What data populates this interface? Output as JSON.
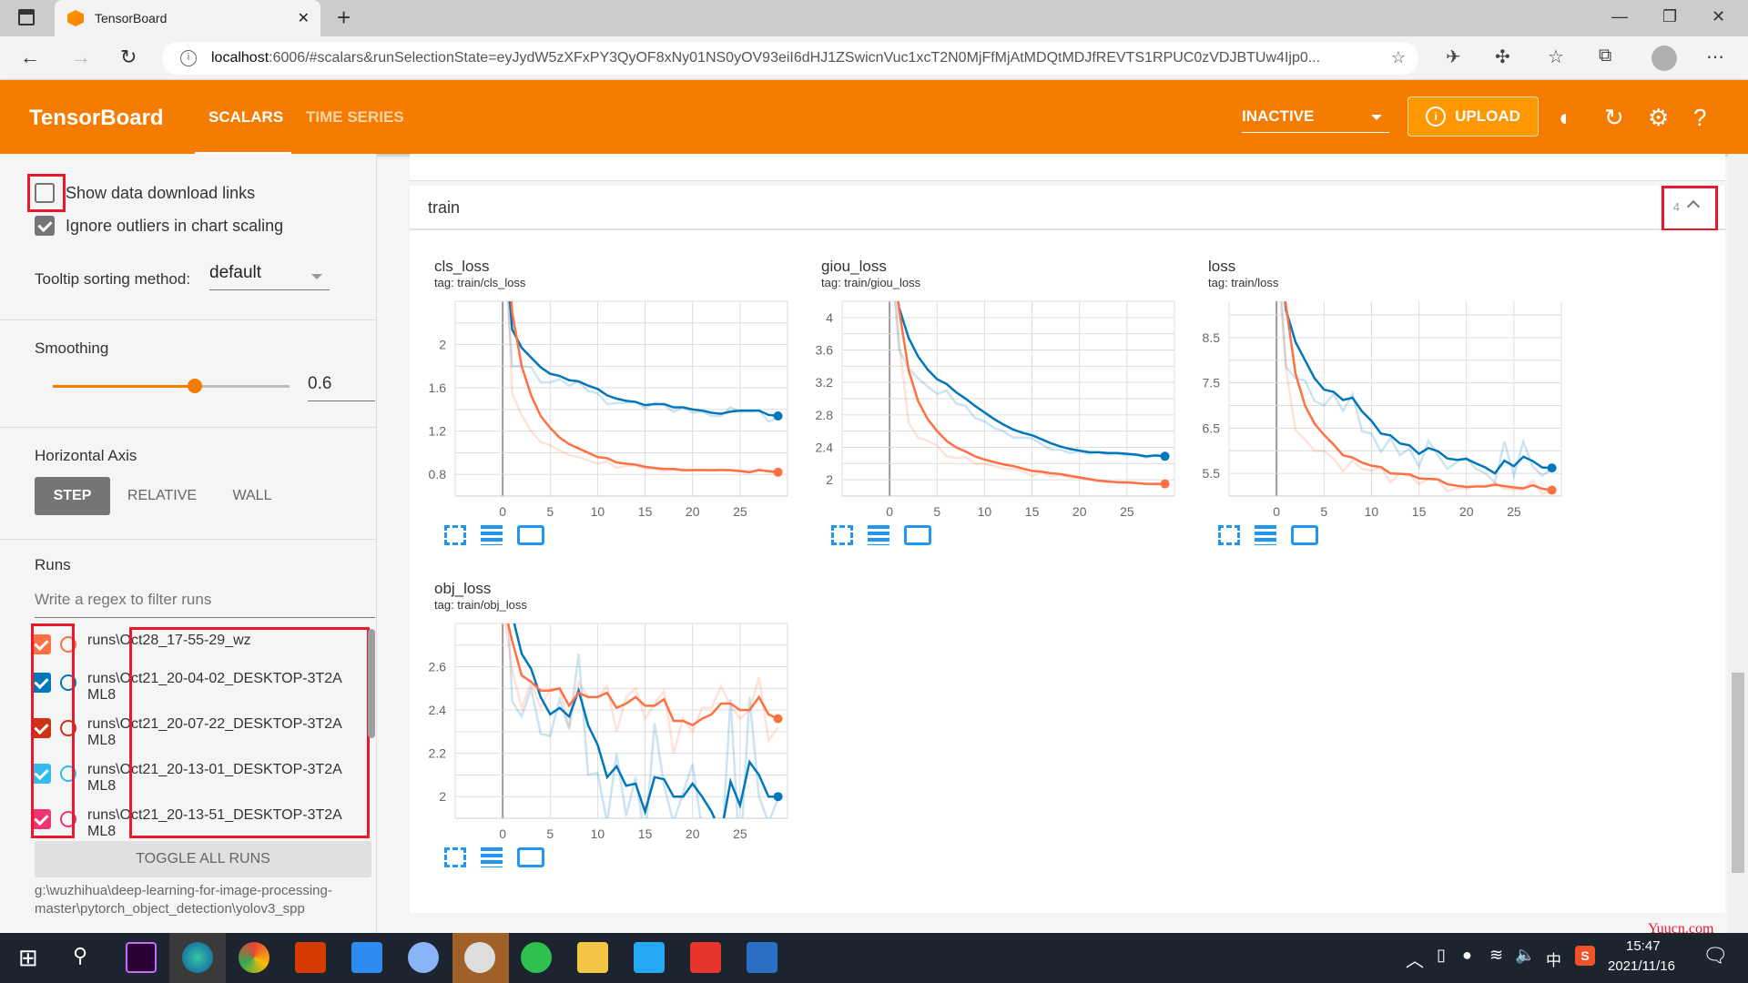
{
  "browser": {
    "tab_title": "TensorBoard",
    "url_host": "localhost",
    "url_rest": ":6006/#scalars&runSelectionState=eyJydW5zXFxPY3QyOF8xNy01NS0yOV93eiI6dHJ1ZSwicnVuc1xcT2N0MjFfMjAtMDQtMDJfREVTS1RPUC0zVDJBTUw4Ijp0..."
  },
  "toolbar": {
    "brand": "TensorBoard",
    "tabs": [
      {
        "label": "SCALARS",
        "active": true
      },
      {
        "label": "TIME SERIES",
        "active": false
      }
    ],
    "run_selector": "INACTIVE",
    "upload_label": "UPLOAD"
  },
  "sidebar": {
    "show_download_links": {
      "label": "Show data download links",
      "checked": false
    },
    "ignore_outliers": {
      "label": "Ignore outliers in chart scaling",
      "checked": true
    },
    "tooltip_label": "Tooltip sorting method:",
    "tooltip_value": "default",
    "smoothing_label": "Smoothing",
    "smoothing_value": "0.6",
    "smoothing_fraction": 0.6,
    "horizontal_axis_label": "Horizontal Axis",
    "axis_options": [
      "STEP",
      "RELATIVE",
      "WALL"
    ],
    "axis_selected": "STEP",
    "runs_label": "Runs",
    "filter_placeholder": "Write a regex to filter runs",
    "runs": [
      {
        "name": "runs\\Oct28_17-55-29_wz",
        "color": "#ff7043",
        "checked": true
      },
      {
        "name": "runs\\Oct21_20-04-02_DESKTOP-3T2AML8",
        "color": "#0077bb",
        "checked": true
      },
      {
        "name": "runs\\Oct21_20-07-22_DESKTOP-3T2AML8",
        "color": "#cc3311",
        "checked": true
      },
      {
        "name": "runs\\Oct21_20-13-01_DESKTOP-3T2AML8",
        "color": "#33bbee",
        "checked": true
      },
      {
        "name": "runs\\Oct21_20-13-51_DESKTOP-3T2AML8",
        "color": "#ee3377",
        "checked": true
      }
    ],
    "toggle_all": "TOGGLE ALL RUNS",
    "logdir": "g:\\wuzhihua\\deep-learning-for-image-processing-master\\pytorch_object_detection\\yolov3_spp"
  },
  "category": {
    "name": "train",
    "count": "4"
  },
  "chart_data": [
    {
      "type": "line",
      "title": "cls_loss",
      "tag": "tag: train/cls_loss",
      "xlim": [
        -5,
        30
      ],
      "ylim": [
        0.6,
        2.4
      ],
      "xticks": [
        0,
        5,
        10,
        15,
        20,
        25
      ],
      "yticks": [
        0.8,
        1.2,
        1.6,
        2
      ],
      "series": [
        {
          "name": "runs\\Oct21_20-04-02_DESKTOP-3T2AML8",
          "color": "#0077bb",
          "raw": [
            3.2,
            1.8,
            1.8,
            1.79,
            1.65,
            1.65,
            1.68,
            1.62,
            1.66,
            1.57,
            1.55,
            1.45,
            1.46,
            1.46,
            1.47,
            1.41,
            1.46,
            1.44,
            1.38,
            1.42,
            1.37,
            1.38,
            1.34,
            1.34,
            1.42,
            1.38,
            1.38,
            1.39,
            1.29,
            1.32
          ],
          "smoothed": [
            3.2,
            2.14,
            1.97,
            1.88,
            1.79,
            1.73,
            1.71,
            1.67,
            1.66,
            1.62,
            1.59,
            1.53,
            1.5,
            1.48,
            1.47,
            1.44,
            1.45,
            1.45,
            1.42,
            1.42,
            1.4,
            1.39,
            1.37,
            1.36,
            1.38,
            1.39,
            1.39,
            1.39,
            1.35,
            1.34
          ]
        },
        {
          "name": "runs\\Oct28_17-55-29_wz",
          "color": "#ff7043",
          "raw": [
            3.5,
            1.55,
            1.35,
            1.2,
            1.1,
            1.07,
            1.02,
            0.98,
            0.96,
            0.93,
            0.9,
            0.92,
            0.86,
            0.88,
            0.88,
            0.86,
            0.85,
            0.83,
            0.85,
            0.83,
            0.84,
            0.84,
            0.83,
            0.85,
            0.83,
            0.84,
            0.82,
            0.85,
            0.82,
            0.82
          ],
          "smoothed": [
            3.5,
            2.3,
            1.8,
            1.53,
            1.34,
            1.23,
            1.14,
            1.08,
            1.04,
            1.0,
            0.96,
            0.95,
            0.91,
            0.9,
            0.89,
            0.87,
            0.86,
            0.85,
            0.85,
            0.84,
            0.84,
            0.84,
            0.84,
            0.84,
            0.84,
            0.83,
            0.82,
            0.84,
            0.83,
            0.82
          ]
        }
      ]
    },
    {
      "type": "line",
      "title": "giou_loss",
      "tag": "tag: train/giou_loss",
      "xlim": [
        -5,
        30
      ],
      "ylim": [
        1.8,
        4.2
      ],
      "xticks": [
        0,
        5,
        10,
        15,
        20,
        25
      ],
      "yticks": [
        2,
        2.4,
        2.8,
        3.2,
        3.6,
        4
      ],
      "series": [
        {
          "name": "runs\\Oct21_20-04-02_DESKTOP-3T2AML8",
          "color": "#0077bb",
          "raw": [
            5.0,
            3.6,
            3.38,
            3.25,
            3.15,
            3.06,
            3.1,
            2.94,
            2.91,
            2.76,
            2.72,
            2.64,
            2.6,
            2.52,
            2.52,
            2.51,
            2.44,
            2.37,
            2.37,
            2.33,
            2.35,
            2.32,
            2.34,
            2.31,
            2.32,
            2.3,
            2.31,
            2.27,
            2.31,
            2.29
          ],
          "smoothed": [
            5.0,
            4.12,
            3.75,
            3.52,
            3.36,
            3.24,
            3.18,
            3.08,
            3.0,
            2.91,
            2.83,
            2.75,
            2.68,
            2.62,
            2.58,
            2.55,
            2.5,
            2.45,
            2.41,
            2.38,
            2.36,
            2.34,
            2.34,
            2.33,
            2.33,
            2.32,
            2.31,
            2.29,
            2.3,
            2.29
          ]
        },
        {
          "name": "runs\\Oct28_17-55-29_wz",
          "color": "#ff7043",
          "raw": [
            5.2,
            3.7,
            2.7,
            2.52,
            2.48,
            2.42,
            2.29,
            2.27,
            2.28,
            2.2,
            2.2,
            2.17,
            2.14,
            2.13,
            2.11,
            2.05,
            2.09,
            2.04,
            2.06,
            2.03,
            2.02,
            2.0,
            1.98,
            1.98,
            1.97,
            1.96,
            1.96,
            1.95,
            1.94,
            1.95
          ],
          "smoothed": [
            5.2,
            4.1,
            3.35,
            2.97,
            2.75,
            2.6,
            2.48,
            2.4,
            2.35,
            2.29,
            2.25,
            2.22,
            2.19,
            2.17,
            2.14,
            2.11,
            2.1,
            2.08,
            2.07,
            2.05,
            2.03,
            2.01,
            1.99,
            1.98,
            1.97,
            1.97,
            1.96,
            1.95,
            1.95,
            1.95
          ]
        }
      ]
    },
    {
      "type": "line",
      "title": "loss",
      "tag": "tag: train/loss",
      "xlim": [
        -5,
        30
      ],
      "ylim": [
        5.0,
        9.3
      ],
      "xticks": [
        0,
        5,
        10,
        15,
        20,
        25
      ],
      "yticks": [
        5.5,
        6.5,
        7.5,
        8.5
      ],
      "series": [
        {
          "name": "runs\\Oct21_20-04-02_DESKTOP-3T2AML8",
          "color": "#0077bb",
          "raw": [
            11.0,
            7.85,
            7.6,
            7.55,
            7.1,
            7.0,
            7.25,
            6.88,
            7.25,
            6.43,
            6.38,
            5.97,
            6.28,
            5.9,
            6.05,
            5.65,
            6.22,
            5.9,
            5.6,
            5.75,
            5.85,
            5.6,
            5.5,
            5.3,
            6.2,
            5.45,
            6.2,
            5.65,
            5.45,
            5.6
          ],
          "smoothed": [
            11.0,
            9.1,
            8.4,
            8.0,
            7.6,
            7.35,
            7.3,
            7.12,
            7.17,
            6.87,
            6.66,
            6.38,
            6.34,
            6.16,
            6.12,
            5.93,
            6.06,
            5.99,
            5.83,
            5.8,
            5.82,
            5.72,
            5.63,
            5.5,
            5.78,
            5.66,
            5.87,
            5.77,
            5.63,
            5.62
          ]
        },
        {
          "name": "runs\\Oct28_17-55-29_wz",
          "color": "#ff7043",
          "raw": [
            10.5,
            7.8,
            6.45,
            6.25,
            6.0,
            6.0,
            5.83,
            5.55,
            5.78,
            5.6,
            5.56,
            5.64,
            5.3,
            5.5,
            5.45,
            5.26,
            5.38,
            5.36,
            5.1,
            5.18,
            5.16,
            5.22,
            5.22,
            5.3,
            5.16,
            5.15,
            5.14,
            5.34,
            5.05,
            5.12
          ],
          "smoothed": [
            10.5,
            9.2,
            7.7,
            7.0,
            6.6,
            6.35,
            6.14,
            5.9,
            5.85,
            5.74,
            5.67,
            5.64,
            5.5,
            5.49,
            5.48,
            5.39,
            5.38,
            5.37,
            5.26,
            5.23,
            5.2,
            5.21,
            5.21,
            5.25,
            5.22,
            5.19,
            5.17,
            5.24,
            5.16,
            5.13
          ]
        }
      ]
    },
    {
      "type": "line",
      "title": "obj_loss",
      "tag": "tag: train/obj_loss",
      "xlim": [
        -5,
        30
      ],
      "ylim": [
        1.9,
        2.8
      ],
      "xticks": [
        0,
        5,
        10,
        15,
        20,
        25
      ],
      "yticks": [
        2,
        2.2,
        2.4,
        2.6
      ],
      "series": [
        {
          "name": "runs\\Oct21_20-04-02_DESKTOP-3T2AML8",
          "color": "#0077bb",
          "raw": [
            3.4,
            2.44,
            2.37,
            2.5,
            2.29,
            2.28,
            2.45,
            2.31,
            2.66,
            2.1,
            2.11,
            1.88,
            2.2,
            1.91,
            2.09,
            1.8,
            2.34,
            2.05,
            1.88,
            2.02,
            2.15,
            1.85,
            1.7,
            1.7,
            2.45,
            1.7,
            2.46,
            2.0,
            1.88,
            1.99
          ],
          "smoothed": [
            3.4,
            2.84,
            2.66,
            2.59,
            2.46,
            2.38,
            2.41,
            2.37,
            2.49,
            2.33,
            2.24,
            2.09,
            2.14,
            2.05,
            2.06,
            1.93,
            2.09,
            2.08,
            2.0,
            2.0,
            2.06,
            2.0,
            1.93,
            1.83,
            2.07,
            1.96,
            2.16,
            2.1,
            2.0,
            2.0
          ]
        },
        {
          "name": "runs\\Oct28_17-55-29_wz",
          "color": "#ff7043",
          "raw": [
            2.9,
            2.58,
            2.41,
            2.53,
            2.41,
            2.5,
            2.5,
            2.32,
            2.53,
            2.46,
            2.46,
            2.51,
            2.3,
            2.46,
            2.5,
            2.36,
            2.43,
            2.49,
            2.2,
            2.36,
            2.3,
            2.41,
            2.41,
            2.51,
            2.42,
            2.36,
            2.4,
            2.55,
            2.26,
            2.32
          ],
          "smoothed": [
            2.9,
            2.72,
            2.56,
            2.53,
            2.49,
            2.49,
            2.5,
            2.42,
            2.48,
            2.46,
            2.46,
            2.48,
            2.41,
            2.43,
            2.46,
            2.42,
            2.42,
            2.45,
            2.35,
            2.35,
            2.33,
            2.36,
            2.38,
            2.43,
            2.43,
            2.4,
            2.4,
            2.46,
            2.38,
            2.36
          ]
        }
      ]
    }
  ],
  "taskbar": {
    "time": "15:47",
    "date": "2021/11/16",
    "ime": "中",
    "watermark": "Yuucn.com"
  }
}
